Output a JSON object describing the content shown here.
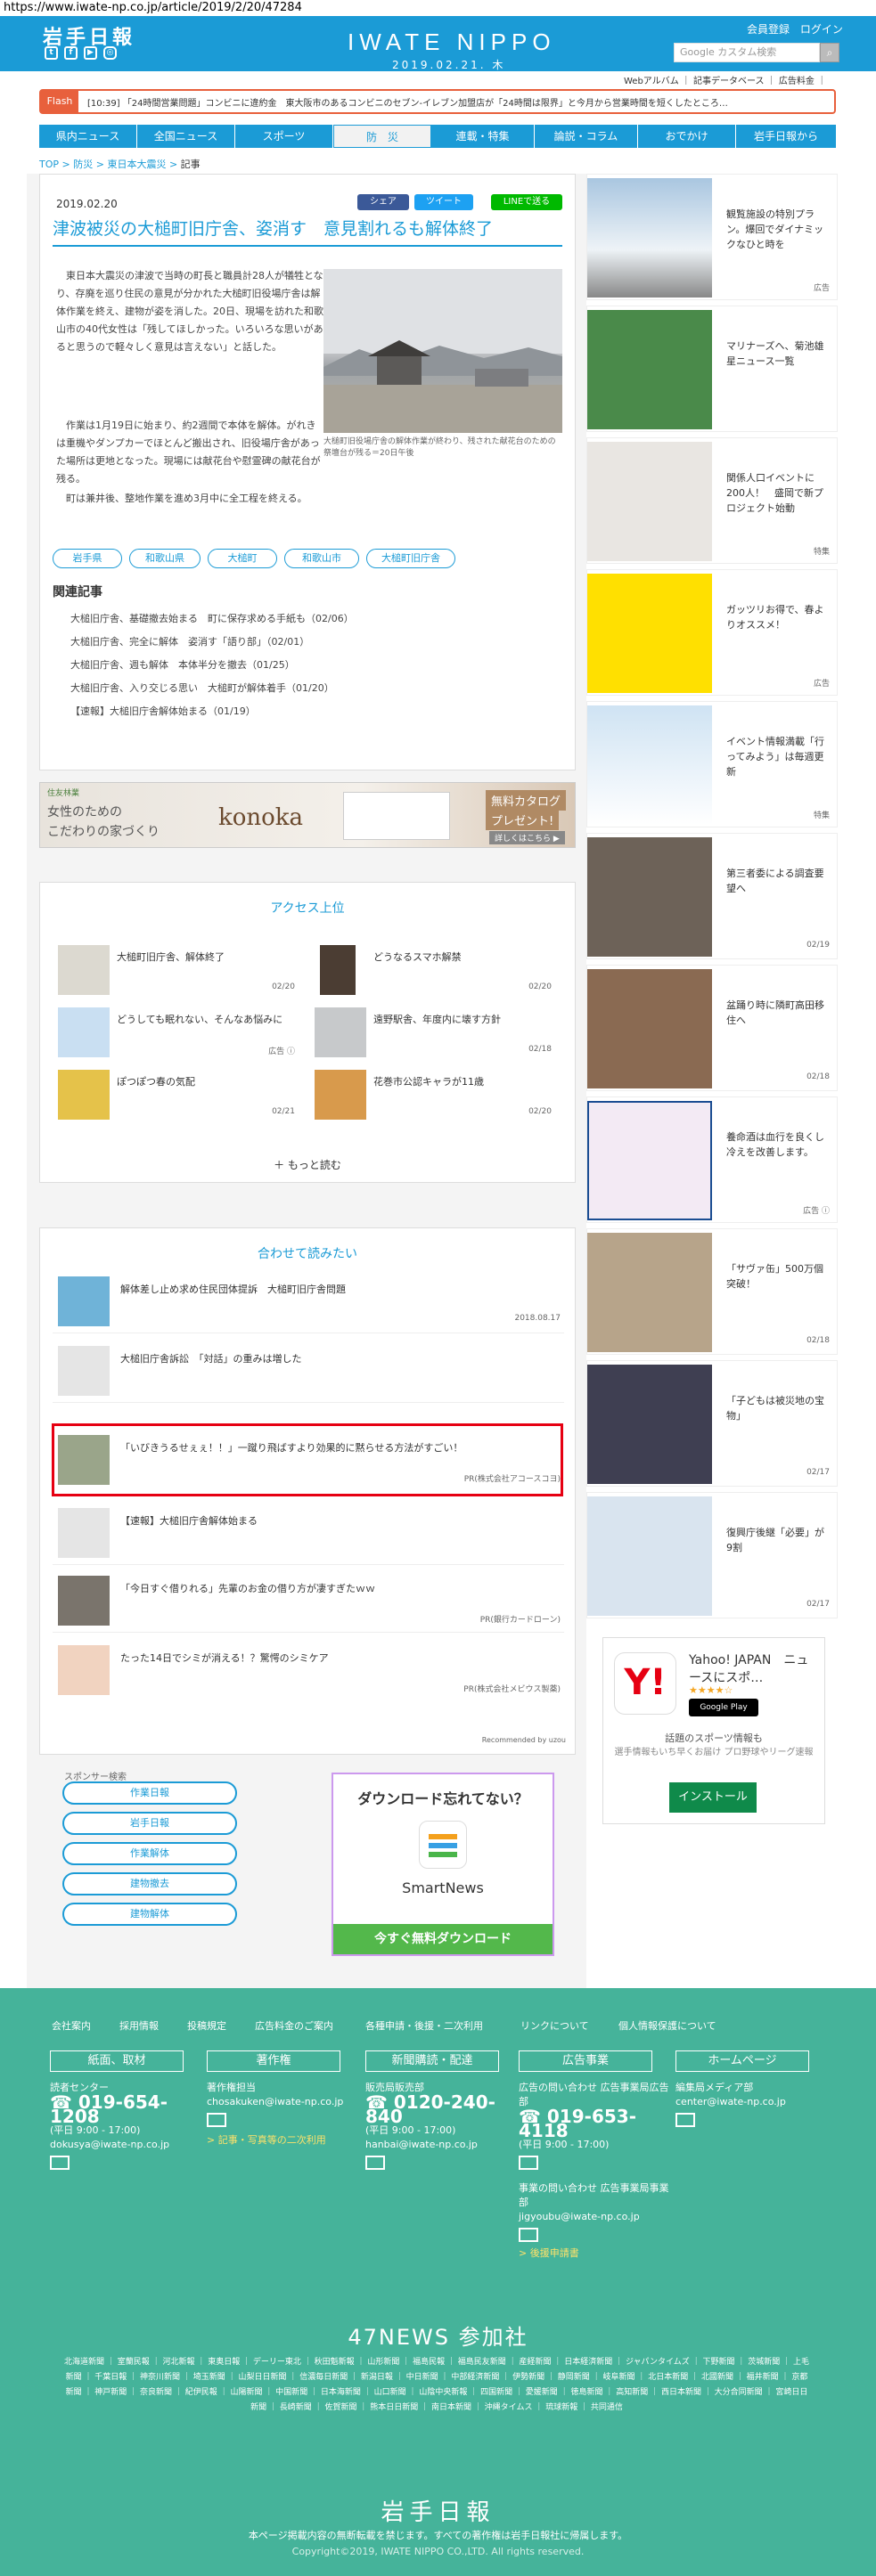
{
  "url": "https://www.iwate-np.co.jp/article/2019/2/20/47284",
  "header": {
    "logo_jp": "岩手日報",
    "logo_en": "IWATE NIPPO",
    "date": "2019.02.21. 木",
    "register": "会員登録",
    "login": "ログイン",
    "search_placeholder": "Google カスタム検索",
    "sublinks": "Webアルバム ｜ 記事データベース ｜ 広告料金 ｜"
  },
  "flash": {
    "label": "Flash",
    "text": "[10:39] 「24時間営業問題」コンビニに違約金　東大阪市のあるコンビニのセブン-イレブン加盟店が「24時間は限界」と今月から営業時間を短くしたところ…"
  },
  "nav": [
    "県内ニュース",
    "全国ニュース",
    "スポーツ",
    "防　災",
    "連載・特集",
    "論説・コラム",
    "おでかけ",
    "岩手日報から"
  ],
  "breadcrumb": {
    "items": [
      "TOP",
      "防災",
      "東日本大震災"
    ],
    "current": "記事"
  },
  "article": {
    "date": "2019.02.20",
    "share": [
      "シェア",
      "ツイート",
      "LINEで送る"
    ],
    "title": "津波被災の大槌町旧庁舎、姿消す　意見割れるも解体終了",
    "paragraphs": [
      "　東日本大震災の津波で当時の町長と職員計28人が犠牲となり、存廃を巡り住民の意見が分かれた大槌町旧役場庁舎は解体作業を終え、建物が姿を消した。20日、現場を訪れた和歌山市の40代女性は「残してほしかった。いろいろな思いがあると思うので軽々しく意見は言えない」と話した。",
      "　作業は1月19日に始まり、約2週間で本体を解体。がれきは重機やダンプカーでほとんど搬出され、旧役場庁舎があった場所は更地となった。現場には献花台や慰霊碑の献花台が残る。",
      "　町は兼井後、整地作業を進め3月中に全工程を終える。"
    ],
    "caption": "大槌町旧役場庁舎の解体作業が終わり、残された献花台のための祭壇台が残る＝20日午後",
    "tags": [
      "岩手県",
      "和歌山県",
      "大槌町",
      "和歌山市",
      "大槌町旧庁舎"
    ],
    "related_title": "関連記事",
    "related": [
      "大槌旧庁舎、基礎撤去始まる　町に保存求める手紙も（02/06）",
      "大槌旧庁舎、完全に解体　姿消す「語り部」（02/01）",
      "大槌旧庁舎、週も解体　本体半分を撤去（01/25）",
      "大槌旧庁舎、入り交じる思い　大槌町が解体着手（01/20）",
      "【速報】大槌旧庁舎解体始まる（01/19）"
    ]
  },
  "ad": {
    "brand": "住友林業",
    "line1": "女性のための",
    "line2": "こだわりの家づくり",
    "logo": "konoka",
    "cta": "無料カタログ",
    "cta2": "プレゼント!",
    "cta3": "詳しくはこちら ▶"
  },
  "access": {
    "title": "アクセス上位",
    "items": [
      {
        "t": "大槌町旧庁舎、解体終了",
        "d": "02/20"
      },
      {
        "t": "どうなるスマホ解禁",
        "d": "02/20"
      },
      {
        "t": "どうしても眠れない、そんなあ悩みに",
        "d": "広告 ⓘ"
      },
      {
        "t": "遠野駅舎、年度内に壊す方針",
        "d": "02/18"
      },
      {
        "t": "ぽつぽつ春の気配",
        "d": "02/21"
      },
      {
        "t": "花巻市公認キャラが11歳",
        "d": "02/20"
      }
    ],
    "more": "＋ もっと読む"
  },
  "together": {
    "title": "合わせて読みたい",
    "items": [
      {
        "t": "解体差し止め求め住民団体提訴　大槌町旧庁舎問題",
        "d": "2018.08.17"
      },
      {
        "t": "大槌旧庁舎訴訟　「対話」の重みは増した",
        "d": ""
      },
      {
        "t": "「いびきうるせぇぇ！！」一蹴り飛ばすより効果的に黙らせる方法がすごい！",
        "d": "PR(株式会社アコースコヨ)"
      },
      {
        "t": "【速報】大槌旧庁舎解体始まる",
        "d": ""
      },
      {
        "t": "「今日すぐ借りれる」先輩のお金の借り方が凄すぎたｗｗ",
        "d": "PR(銀行カードローン)"
      },
      {
        "t": "たった14日でシミが消える！？驚愕のシミケア",
        "d": "PR(株式会社メビウス製薬)"
      }
    ],
    "recommended": "Recommended by uzou"
  },
  "sponsor": {
    "title": "スポンサー検索",
    "buttons": [
      "作業日報",
      "岩手日報",
      "作業解体",
      "建物撤去",
      "建物解体"
    ]
  },
  "smartnews": {
    "headline": "ダウンロード忘れてない？",
    "name": "SmartNews",
    "cta": "今すぐ無料ダウンロード"
  },
  "right": [
    {
      "t": "観覧施設の特別プラン。爆回でダイナミックなひと時を",
      "d": "広告"
    },
    {
      "t": "マリナーズへ、菊池雄星ニュース一覧",
      "d": ""
    },
    {
      "t": "関係人口イベントに200人！　盛岡で新プロジェクト始動",
      "d": "特集"
    },
    {
      "t": "ガッツリお得で、春よりオススメ！",
      "d": "広告"
    },
    {
      "t": "イベント情報満載「行ってみよう」は毎週更新",
      "d": "特集"
    },
    {
      "t": "第三者委による調査要望へ",
      "d": "02/19"
    },
    {
      "t": "盆踊り時に隣町高田移住へ",
      "d": "02/18"
    },
    {
      "t": "養命酒は血行を良くし冷えを改善します。",
      "d": "広告 ⓘ"
    },
    {
      "t": "「サヴァ缶」500万個突破！",
      "d": "02/18"
    },
    {
      "t": "「子どもは被災地の宝物」",
      "d": "02/17"
    },
    {
      "t": "復興庁後継「必要」が9割",
      "d": "02/17"
    }
  ],
  "yahoo": {
    "title": "Yahoo! JAPAN　ニュースにスポ…",
    "sub": "話題のスポーツ情報も",
    "desc": "選手情報もいち早くお届け プロ野球やリーグ速報",
    "store": "Google Play",
    "cta": "インストール"
  },
  "footer": {
    "links": [
      "会社案内",
      "採用情報",
      "投稿規定",
      "広告料金のご案内",
      "各種申請・後援・二次利用",
      "リンクについて",
      "個人情報保護について"
    ],
    "heads": [
      "紙面、取材",
      "著作権",
      "新聞購読・配達",
      "広告事業",
      "ホームページ"
    ],
    "col1": {
      "label": "読者センター",
      "phone": "019-654-1208",
      "hours": "(平日 9:00 - 17:00)",
      "mail": "dokusya@iwate-np.co.jp"
    },
    "col2": {
      "label": "著作権担当",
      "mail": "chosakuken@iwate-np.co.jp",
      "link": "> 記事・写真等の二次利用"
    },
    "col3": {
      "label": "販売局販売部",
      "phone": "0120-240-840",
      "hours": "(平日 9:00 - 17:00)",
      "mail": "hanbai@iwate-np.co.jp"
    },
    "col4": {
      "label": "広告の問い合わせ 広告事業局広告部",
      "phone": "019-653-4118",
      "hours": "(平日 9:00 - 17:00)",
      "label2": "事業の問い合わせ 広告事業局事業部",
      "mail": "jigyoubu@iwate-np.co.jp",
      "link": "> 後援申請書"
    },
    "col5": {
      "label": "編集局メディア部",
      "mail": "center@iwate-np.co.jp"
    },
    "n47title": "47NEWS 参加社",
    "n47list": "北海道新聞 ｜ 室蘭民報 ｜ 河北新報 ｜ 東奥日報 ｜ デーリー東北 ｜ 秋田魁新報 ｜ 山形新聞 ｜ 福島民報 ｜ 福島民友新聞 ｜ 産経新聞 ｜ 日本経済新聞 ｜ ジャパンタイムズ ｜ 下野新聞 ｜ 茨城新聞 ｜ 上毛新聞 ｜ 千葉日報 ｜ 神奈川新聞 ｜ 埼玉新聞 ｜ 山梨日日新聞 ｜ 信濃毎日新聞 ｜ 新潟日報 ｜ 中日新聞 ｜ 中部経済新聞 ｜ 伊勢新聞 ｜ 静岡新聞 ｜ 岐阜新聞 ｜ 北日本新聞 ｜ 北國新聞 ｜ 福井新聞 ｜ 京都新聞 ｜ 神戸新聞 ｜ 奈良新聞 ｜ 紀伊民報 ｜ 山陽新聞 ｜ 中国新聞 ｜ 日本海新聞 ｜ 山口新聞 ｜ 山陰中央新報 ｜ 四国新聞 ｜ 愛媛新聞 ｜ 徳島新聞 ｜ 高知新聞 ｜ 西日本新聞 ｜ 大分合同新聞 ｜ 宮崎日日新聞 ｜ 長崎新聞 ｜ 佐賀新聞 ｜ 熊本日日新聞 ｜ 南日本新聞 ｜ 沖縄タイムス ｜ 琉球新報 ｜ 共同通信",
    "logo": "岩手日報",
    "notice": "本ページ掲載内容の無断転載を禁じます。すべての著作権は岩手日報社に帰属します。",
    "copyright": "Copyright©2019, IWATE NIPPO CO.,LTD. All rights reserved."
  },
  "colors": {
    "brand": "#1b9bd6",
    "footer": "#45b39a",
    "flash": "#e8603c",
    "highlight": "#e60012"
  }
}
